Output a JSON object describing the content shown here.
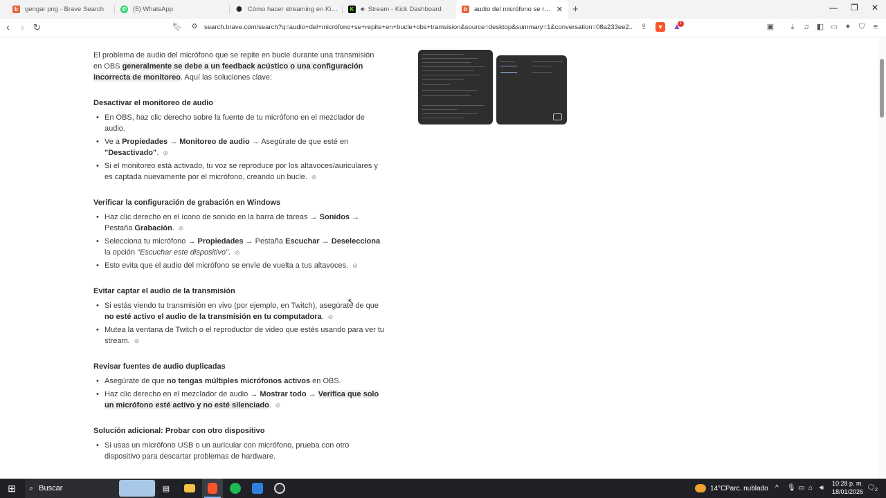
{
  "tabs": [
    {
      "title": "gengar png - Brave Search",
      "icon": "brave-search-icon",
      "color": "#e8643c"
    },
    {
      "title": "(5) WhatsApp",
      "icon": "whatsapp-icon",
      "color": "#25d366"
    },
    {
      "title": "Cómo hacer streaming en Kick con O",
      "icon": "chatgpt-icon",
      "color": "#222222"
    },
    {
      "title": "Stream - Kick Dashboard",
      "icon": "kick-icon",
      "color": "#53fc18"
    },
    {
      "title": "audio del micrófono se repite en",
      "icon": "brave-search-icon",
      "color": "#e8643c"
    }
  ],
  "toolbar": {
    "url": "search.brave.com/search?q=audio+del+micrófono+se+repite+en+bucle+obs+tramsision&source=desktop&summary=1&conversation=08a233ee2...",
    "brave_badge_count": "1"
  },
  "answer": {
    "intro_a": "El problema de audio del micrófono que se repite en bucle durante una transmisión en OBS ",
    "intro_b": "generalmente se debe a un feedback acústico o una configuración incorrecta de monitoreo",
    "intro_c": ". Aquí las soluciones clave:",
    "s1": {
      "heading": "Desactivar el monitoreo de audio",
      "b1": "En OBS, haz clic derecho sobre la fuente de tu micrófono en el mezclador de audio.",
      "b2_a": "Ve a ",
      "b2_b": "Propiedades",
      "b2_c": " → ",
      "b2_d": "Monitoreo de audio",
      "b2_e": " → Asegúrate de que esté en ",
      "b2_f": "\"Desactivado\"",
      "b2_g": ".",
      "b3": "Si el monitoreo está activado, tu voz se reproduce por los altavoces/auriculares y es captada nuevamente por el micrófono, creando un bucle."
    },
    "s2": {
      "heading": "Verificar la configuración de grabación en Windows",
      "b1_a": "Haz clic derecho en el ícono de sonido en la barra de tareas → ",
      "b1_b": "Sonidos",
      "b1_c": " → Pestaña ",
      "b1_d": "Grabación",
      "b1_e": ".",
      "b2_a": "Selecciona tu micrófono → ",
      "b2_b": "Propiedades",
      "b2_c": " → Pestaña ",
      "b2_d": "Escuchar",
      "b2_e": " → ",
      "b2_f": "Deselecciona",
      "b2_g": " la opción ",
      "b2_h": "\"Escuchar este dispositivo\"",
      "b2_i": ".",
      "b3": "Esto evita que el audio del micrófono se envíe de vuelta a tus altavoces."
    },
    "s3": {
      "heading": "Evitar captar el audio de la transmisión",
      "b1_a": "Si estás viendo tu transmisión en vivo (por ejemplo, en Twitch), asegúrate de que ",
      "b1_b": "no esté activo el audio de la transmisión en tu computadora",
      "b1_c": ".",
      "b2": "Mutea la ventana de Twitch o el reproductor de video que estés usando para ver tu stream."
    },
    "s4": {
      "heading": "Revisar fuentes de audio duplicadas",
      "b1_a": "Asegúrate de que ",
      "b1_b": "no tengas múltiples micrófonos activos",
      "b1_c": " en OBS.",
      "b2_a": "Haz clic derecho en el mezclador de audio → ",
      "b2_b": "Mostrar todo",
      "b2_c": " → ",
      "b2_d": "Verifica que solo un micrófono esté activo y no esté silenciado",
      "b2_e": "."
    },
    "s5": {
      "heading": "Solución adicional: Probar con otro dispositivo",
      "b1": "Si usas un micrófono USB o un auricular con micrófono, prueba con otro dispositivo para descartar problemas de hardware."
    }
  },
  "taskbar": {
    "search_label": "Buscar",
    "weather_temp": "14°C",
    "weather_desc": "Parc. nublado",
    "time": "10:28 p. m.",
    "date": "18/01/2026",
    "notification_count": "2"
  }
}
